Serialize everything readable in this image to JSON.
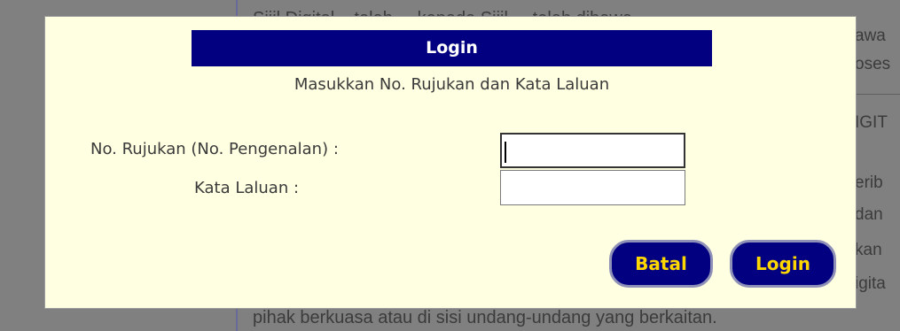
{
  "background": {
    "lines": [
      "Sijil Digital... telah ... kepada Sijil ... telah dibawa",
      "pihak berkuasa atau di sisi undang-undang yang berkaitan."
    ],
    "right_fragments": [
      "awa",
      "oses",
      "IGIT",
      "erib",
      "dan",
      "kan",
      "igita"
    ]
  },
  "dialog": {
    "title": "Login",
    "subtitle": "Masukkan No. Rujukan dan Kata Laluan",
    "fields": {
      "reference_label": "No. Rujukan (No. Pengenalan) :",
      "reference_value": "",
      "password_label": "Kata Laluan :",
      "password_value": ""
    },
    "buttons": {
      "cancel": "Batal",
      "login": "Login"
    }
  },
  "colors": {
    "dialog_bg": "#ffffe1",
    "title_bg": "#020080",
    "button_bg": "#020080",
    "button_text": "#ffd700",
    "overlay": "#808080"
  }
}
